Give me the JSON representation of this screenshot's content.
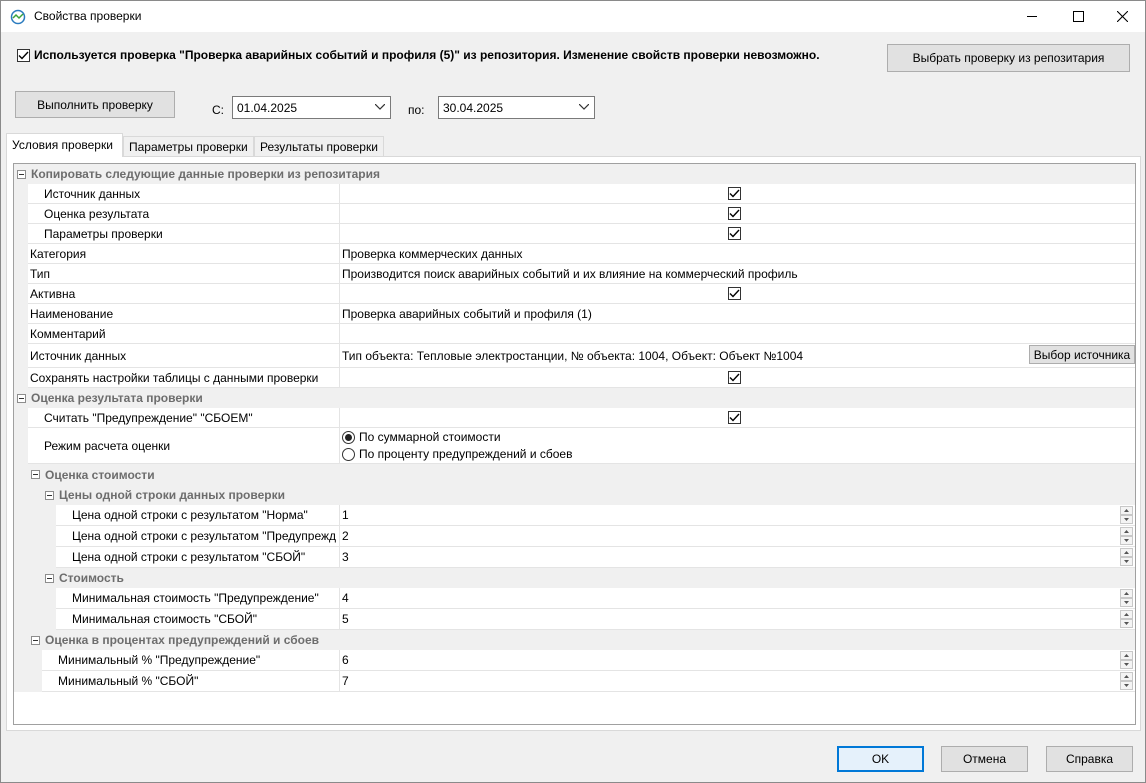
{
  "window": {
    "title": "Свойства проверки"
  },
  "top": {
    "repo_checkbox_checked": true,
    "repo_notice": "Используется проверка \"Проверка аварийных событий и профиля (5)\" из репозитория. Изменение свойств проверки невозможно.",
    "choose_from_repo_label": "Выбрать проверку из репозитария",
    "run_check_label": "Выполнить проверку",
    "from_label": "С:",
    "from_value": "01.04.2025",
    "to_label": "по:",
    "to_value": "30.04.2025"
  },
  "tabs": [
    {
      "label": "Условия проверки",
      "active": true
    },
    {
      "label": "Параметры проверки",
      "active": false
    },
    {
      "label": "Результаты проверки",
      "active": false
    }
  ],
  "grid": {
    "copy_group": "Копировать следующие данные проверки из репозитария",
    "copy_items": [
      {
        "label": "Источник данных",
        "checked": true
      },
      {
        "label": "Оценка результата",
        "checked": true
      },
      {
        "label": "Параметры проверки",
        "checked": true
      }
    ],
    "category": {
      "label": "Категория",
      "value": "Проверка коммерческих данных"
    },
    "type": {
      "label": "Тип",
      "value": "Производится поиск аварийных событий и их влияние на коммерческий профиль"
    },
    "active": {
      "label": "Активна",
      "checked": true
    },
    "name": {
      "label": "Наименование",
      "value": "Проверка аварийных событий и профиля (1)"
    },
    "comment": {
      "label": "Комментарий",
      "value": ""
    },
    "source": {
      "label": "Источник данных",
      "value": "Тип объекта: Тепловые электростанции, № объекта: 1004, Объект: Объект №1004",
      "button": "Выбор источника"
    },
    "save_settings": {
      "label": "Сохранять настройки таблицы с данными проверки",
      "checked": true
    },
    "eval_group": "Оценка результата проверки",
    "count_warning": {
      "label": "Считать \"Предупреждение\" \"СБОЕМ\"",
      "checked": true
    },
    "mode": {
      "label": "Режим расчета оценки",
      "options": [
        "По суммарной стоимости",
        "По проценту предупреждений и сбоев"
      ],
      "selected": 0
    },
    "cost_group": "Оценка стоимости",
    "row_price_group": "Цены одной строки данных проверки",
    "row_prices": [
      {
        "label": "Цена одной строки с результатом \"Норма\"",
        "value": "1"
      },
      {
        "label": "Цена одной строки с результатом \"Предупрежд",
        "value": "2"
      },
      {
        "label": "Цена одной строки с результатом \"СБОЙ\"",
        "value": "3"
      }
    ],
    "cost_subgroup": "Стоимость",
    "min_costs": [
      {
        "label": "Минимальная стоимость \"Предупреждение\"",
        "value": "4"
      },
      {
        "label": "Минимальная стоимость \"СБОЙ\"",
        "value": "5"
      }
    ],
    "percent_group": "Оценка в процентах предупреждений и сбоев",
    "percents": [
      {
        "label": "Минимальный % \"Предупреждение\"",
        "value": "6"
      },
      {
        "label": "Минимальный % \"СБОЙ\"",
        "value": "7"
      }
    ]
  },
  "footer": {
    "ok": "OK",
    "cancel": "Отмена",
    "help": "Справка"
  }
}
